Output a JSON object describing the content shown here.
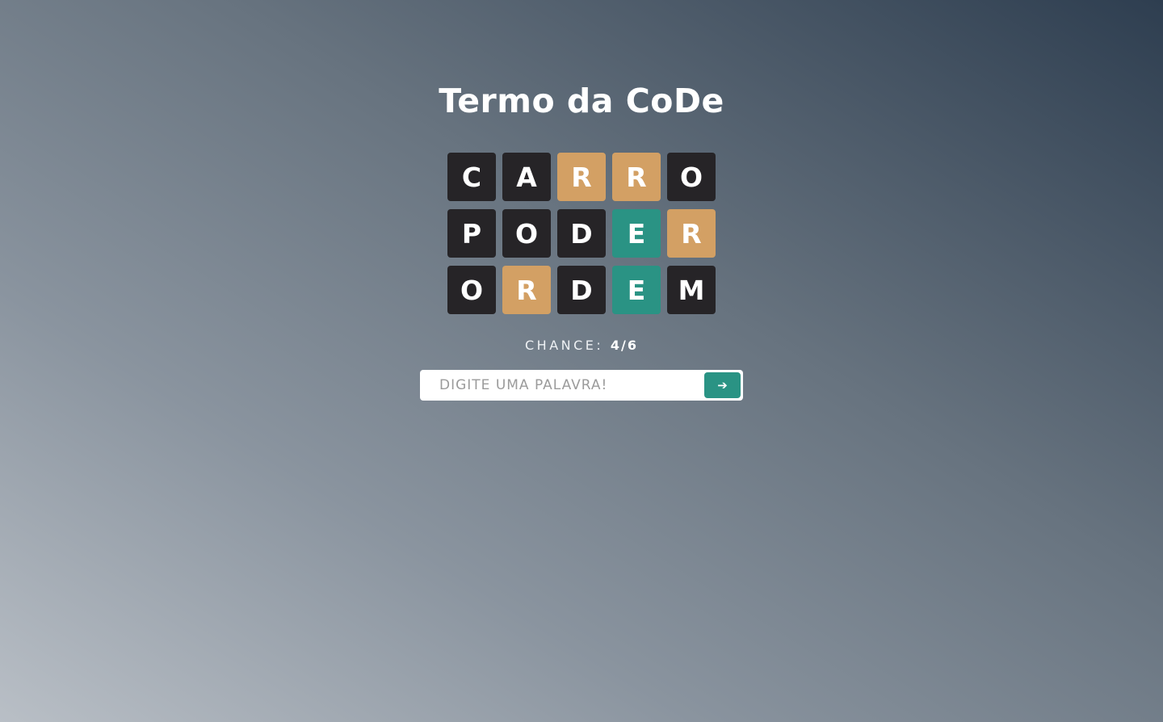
{
  "title": "Termo da CoDe",
  "colors": {
    "absent": "#262427",
    "present": "#d3a064",
    "correct": "#2a9384"
  },
  "board": [
    [
      {
        "letter": "C",
        "state": "absent"
      },
      {
        "letter": "A",
        "state": "absent"
      },
      {
        "letter": "R",
        "state": "present"
      },
      {
        "letter": "R",
        "state": "present"
      },
      {
        "letter": "O",
        "state": "absent"
      }
    ],
    [
      {
        "letter": "P",
        "state": "absent"
      },
      {
        "letter": "O",
        "state": "absent"
      },
      {
        "letter": "D",
        "state": "absent"
      },
      {
        "letter": "E",
        "state": "correct"
      },
      {
        "letter": "R",
        "state": "present"
      }
    ],
    [
      {
        "letter": "O",
        "state": "absent"
      },
      {
        "letter": "R",
        "state": "present"
      },
      {
        "letter": "D",
        "state": "absent"
      },
      {
        "letter": "E",
        "state": "correct"
      },
      {
        "letter": "M",
        "state": "absent"
      }
    ]
  ],
  "chance": {
    "label": "CHANCE:",
    "value": "4/6"
  },
  "input": {
    "placeholder": "DIGITE UMA PALAVRA!",
    "value": ""
  },
  "submit": {
    "icon": "arrow-right-icon",
    "glyph": "➔"
  }
}
